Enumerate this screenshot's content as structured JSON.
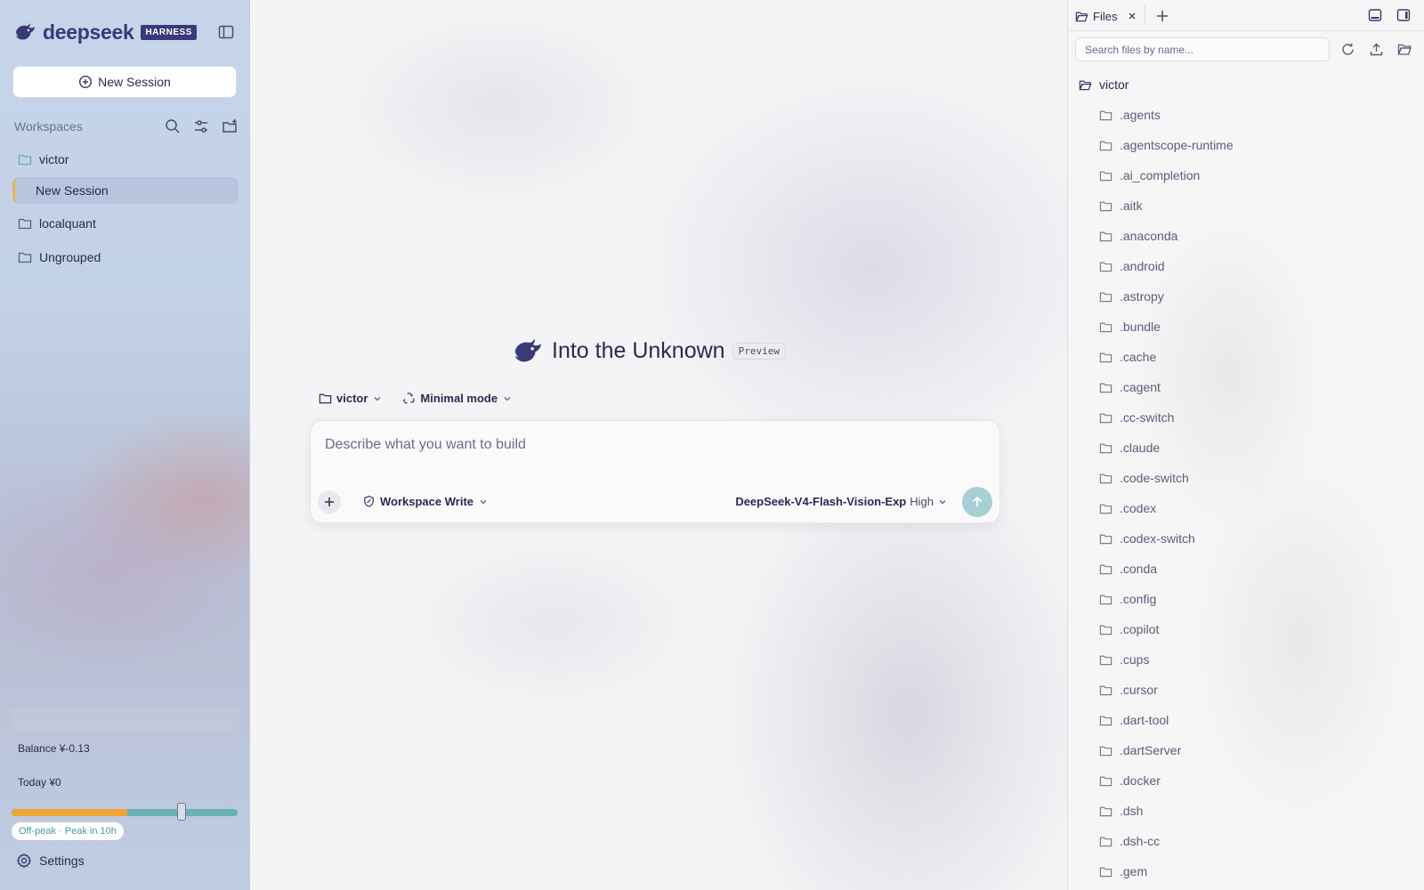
{
  "sidebar": {
    "brand": {
      "name": "deepseek",
      "badge": "HARNESS"
    },
    "new_session_label": "New Session",
    "workspaces_title": "Workspaces",
    "items": [
      {
        "label": "victor"
      },
      {
        "label": "New Session"
      },
      {
        "label": "localquant"
      },
      {
        "label": "Ungrouped"
      }
    ],
    "balance": "Balance ¥-0.13",
    "today": "Today ¥0",
    "peak": {
      "label": "Off-peak · Peak in 10h",
      "fill_fraction": 0.51
    },
    "settings_label": "Settings"
  },
  "main": {
    "title": "Into the Unknown",
    "badge": "Preview",
    "workspace_chip": "victor",
    "mode_chip": "Minimal mode",
    "composer": {
      "placeholder": "Describe what you want to build",
      "permission": "Workspace Write",
      "model": "DeepSeek-V4-Flash-Vision-Exp",
      "effort": "High"
    }
  },
  "files": {
    "tab_label": "Files",
    "search_placeholder": "Search files by name...",
    "root": "victor",
    "items": [
      ".agents",
      ".agentscope-runtime",
      ".ai_completion",
      ".aitk",
      ".anaconda",
      ".android",
      ".astropy",
      ".bundle",
      ".cache",
      ".cagent",
      ".cc-switch",
      ".claude",
      ".code-switch",
      ".codex",
      ".codex-switch",
      ".conda",
      ".config",
      ".copilot",
      ".cups",
      ".cursor",
      ".dart-tool",
      ".dartServer",
      ".docker",
      ".dsh",
      ".dsh-cc",
      ".gem"
    ]
  },
  "colors": {
    "brand": "#3a3a78",
    "accent_teal": "#6ab0b8",
    "peak_orange": "#f0a434",
    "session_marker": "#e6b458",
    "send_button": "#a8cfd3"
  },
  "icons": {
    "brand": "whale-logo-icon",
    "collapse": "sidebar-toggle-icon",
    "new_session": "plus-circle-icon",
    "search": "search-icon",
    "filter": "sliders-icon",
    "new_folder": "folder-plus-icon",
    "folder": "folder-icon",
    "settings": "gear-icon",
    "send": "arrow-up-icon",
    "refresh": "refresh-icon",
    "upload": "upload-icon",
    "open_folder": "folder-open-icon"
  }
}
